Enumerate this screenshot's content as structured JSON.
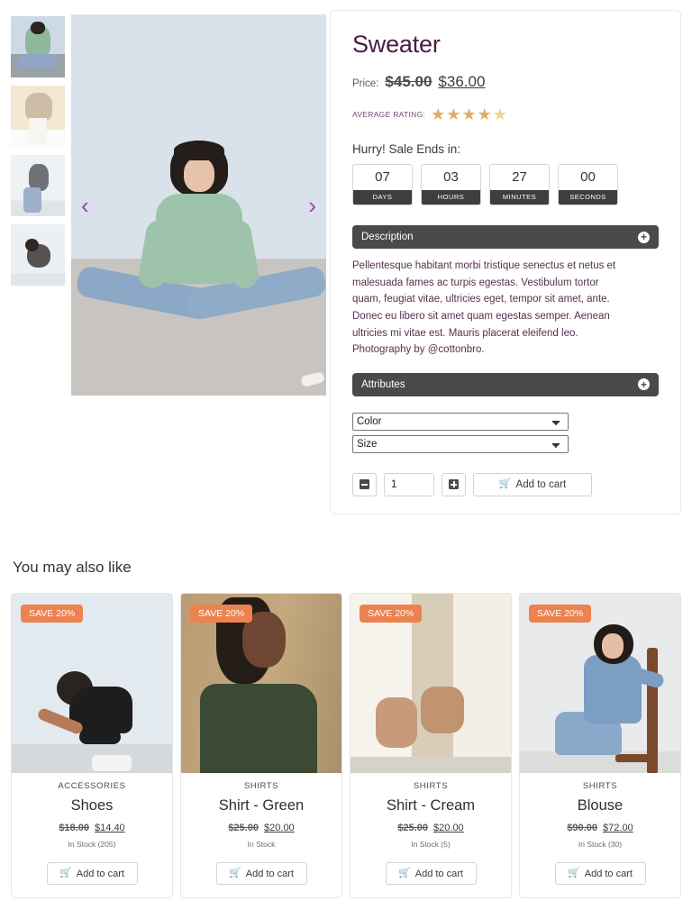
{
  "gallery": {
    "prev_arrow": "‹",
    "next_arrow": "›",
    "thumbnails": [
      {
        "alt": "sweater-front"
      },
      {
        "alt": "beige-top"
      },
      {
        "alt": "grey-top"
      },
      {
        "alt": "dark-outfit"
      }
    ]
  },
  "product": {
    "title": "Sweater",
    "price_label": "Price:",
    "price_old": "$45.00",
    "price_new": "$36.00",
    "rating_label": "AVERAGE RATING:",
    "stars": [
      "★",
      "★",
      "★",
      "★",
      "★"
    ],
    "rating_value": 4.5,
    "sale_text": "Hurry! Sale Ends in:",
    "countdown": [
      {
        "value": "07",
        "unit": "DAYS"
      },
      {
        "value": "03",
        "unit": "HOURS"
      },
      {
        "value": "27",
        "unit": "MINUTES"
      },
      {
        "value": "00",
        "unit": "SECONDS"
      }
    ],
    "description_heading": "Description",
    "description_body": "Pellentesque habitant morbi tristique senectus et netus et malesuada fames ac turpis egestas. Vestibulum tortor quam, feugiat vitae, ultricies eget, tempor sit amet, ante. Donec eu libero sit amet quam egestas semper. Aenean ultricies mi vitae est. Mauris placerat eleifend leo. Photography by @cottonbro.",
    "attributes_heading": "Attributes",
    "accordion_toggle": "+",
    "selects": [
      {
        "name": "color",
        "selected": "Color"
      },
      {
        "name": "size",
        "selected": "Size"
      }
    ],
    "quantity": "1",
    "decrease_label": "−",
    "increase_label": "+",
    "add_to_cart": "Add to cart",
    "cart_icon": "🛒"
  },
  "related": {
    "heading": "You may also like",
    "badge_text": "SAVE 20%",
    "cards": [
      {
        "category": "ACCESSORIES",
        "name": "Shoes",
        "price_old": "$18.00",
        "price_new": "$14.40",
        "stock": "In Stock (205)",
        "add_to_cart": "Add to cart"
      },
      {
        "category": "SHIRTS",
        "name": "Shirt - Green",
        "price_old": "$25.00",
        "price_new": "$20.00",
        "stock": "In Stock",
        "add_to_cart": "Add to cart"
      },
      {
        "category": "SHIRTS",
        "name": "Shirt - Cream",
        "price_old": "$25.00",
        "price_new": "$20.00",
        "stock": "In Stock (5)",
        "add_to_cart": "Add to cart"
      },
      {
        "category": "SHIRTS",
        "name": "Blouse",
        "price_old": "$90.00",
        "price_new": "$72.00",
        "stock": "In Stock (30)",
        "add_to_cart": "Add to cart"
      }
    ]
  },
  "colors": {
    "title": "#4a1b43",
    "badge": "#ec8250",
    "star": "#e8a968",
    "accordion": "#4a4a4a",
    "arrow": "#9b3fb5"
  }
}
